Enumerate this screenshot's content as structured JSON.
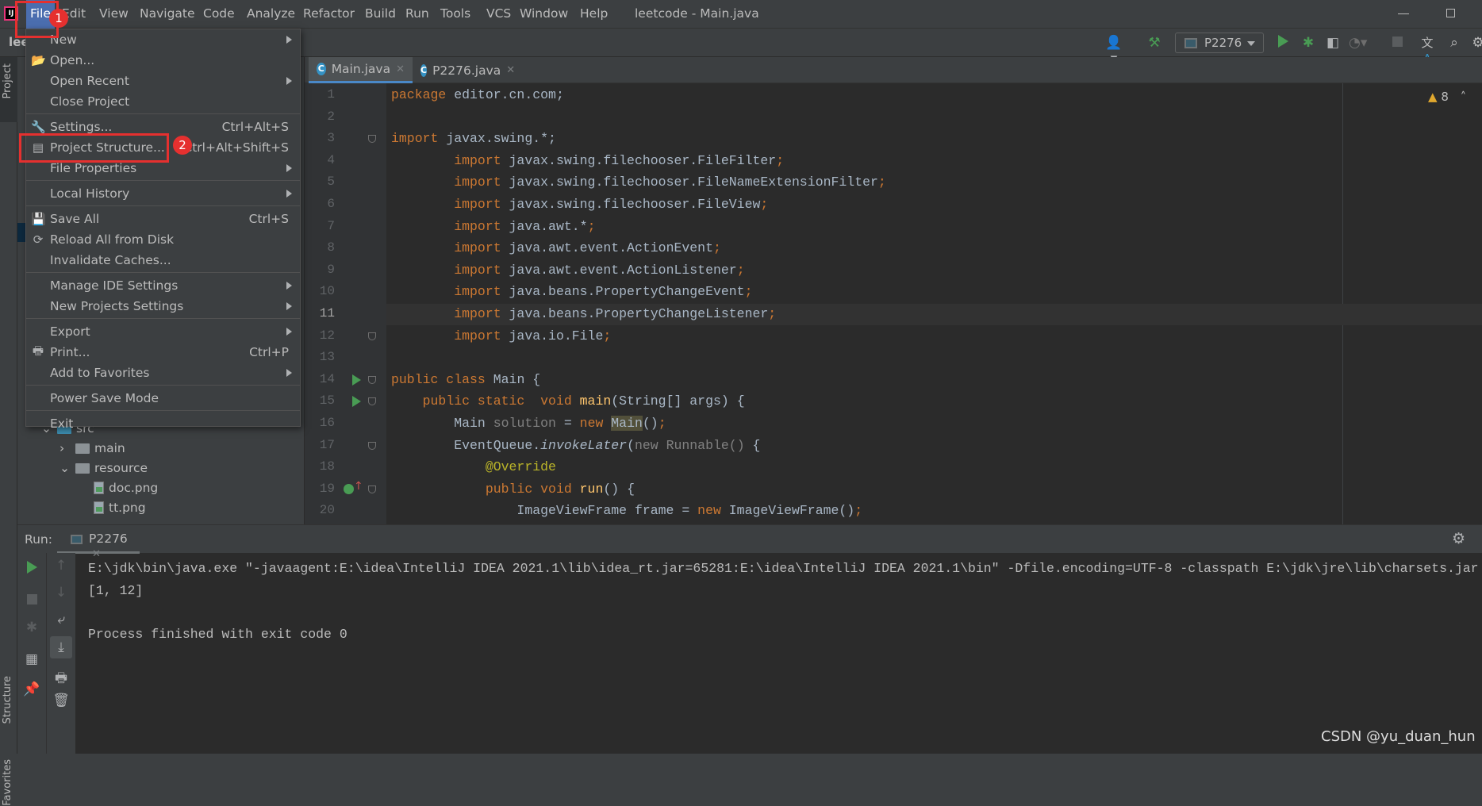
{
  "window": {
    "title": "leetcode - Main.java",
    "minimize_icon": "minimize-icon",
    "restore_icon": "restore-icon"
  },
  "menubar": [
    "File",
    "Edit",
    "View",
    "Navigate",
    "Code",
    "Analyze",
    "Refactor",
    "Build",
    "Run",
    "Tools",
    "VCS",
    "Window",
    "Help"
  ],
  "toolbar": {
    "project_name": "lee",
    "run_config": "P2276",
    "warnings": "8"
  },
  "sidebar_tabs": {
    "project": "Project",
    "structure": "Structure",
    "favorites": "Favorites"
  },
  "file_menu": [
    {
      "label": "New",
      "submenu": true
    },
    {
      "label": "Open...",
      "icon": "folder-open-icon"
    },
    {
      "label": "Open Recent",
      "submenu": true
    },
    {
      "label": "Close Project",
      "sep_after": true
    },
    {
      "label": "Settings...",
      "shortcut": "Ctrl+Alt+S",
      "icon": "wrench-icon"
    },
    {
      "label": "Project Structure...",
      "shortcut": "Ctrl+Alt+Shift+S",
      "icon": "project-structure-icon"
    },
    {
      "label": "File Properties",
      "submenu": true,
      "sep_after": true
    },
    {
      "label": "Local History",
      "submenu": true,
      "sep_after": true
    },
    {
      "label": "Save All",
      "shortcut": "Ctrl+S",
      "icon": "save-icon"
    },
    {
      "label": "Reload All from Disk",
      "icon": "reload-icon"
    },
    {
      "label": "Invalidate Caches...",
      "sep_after": true
    },
    {
      "label": "Manage IDE Settings",
      "submenu": true
    },
    {
      "label": "New Projects Settings",
      "submenu": true,
      "sep_after": true
    },
    {
      "label": "Export",
      "submenu": true
    },
    {
      "label": "Print...",
      "shortcut": "Ctrl+P",
      "icon": "print-icon"
    },
    {
      "label": "Add to Favorites",
      "submenu": true,
      "sep_after": true
    },
    {
      "label": "Power Save Mode",
      "sep_after": true
    },
    {
      "label": "Exit"
    }
  ],
  "annotations": {
    "step1": "1",
    "step2": "2"
  },
  "project_tree": [
    {
      "label": "src",
      "kind": "folder-src",
      "depth": 0,
      "expanded": true
    },
    {
      "label": "main",
      "kind": "folder",
      "depth": 1,
      "expanded": false
    },
    {
      "label": "resource",
      "kind": "folder",
      "depth": 1,
      "expanded": true
    },
    {
      "label": "doc.png",
      "kind": "image",
      "depth": 2
    },
    {
      "label": "tt.png",
      "kind": "image",
      "depth": 2
    }
  ],
  "tabs": [
    {
      "label": "Main.java",
      "active": true
    },
    {
      "label": "P2276.java",
      "active": false
    }
  ],
  "editor": {
    "current_line": 11,
    "lines": [
      [
        [
          "kw",
          "package "
        ],
        [
          "pl",
          "editor.cn.com;"
        ]
      ],
      [],
      [
        [
          "kw",
          "import "
        ],
        [
          "pl",
          "javax.swing.*;"
        ]
      ],
      [
        [
          "pl",
          "        "
        ],
        [
          "kw",
          "import "
        ],
        [
          "pl",
          "javax.swing.filechooser.FileFilter"
        ],
        [
          "kw",
          ";"
        ]
      ],
      [
        [
          "pl",
          "        "
        ],
        [
          "kw",
          "import "
        ],
        [
          "pl",
          "javax.swing.filechooser.FileNameExtensionFilter"
        ],
        [
          "kw",
          ";"
        ]
      ],
      [
        [
          "pl",
          "        "
        ],
        [
          "kw",
          "import "
        ],
        [
          "pl",
          "javax.swing.filechooser.FileView"
        ],
        [
          "kw",
          ";"
        ]
      ],
      [
        [
          "pl",
          "        "
        ],
        [
          "kw",
          "import "
        ],
        [
          "pl",
          "java.awt.*"
        ],
        [
          "kw",
          ";"
        ]
      ],
      [
        [
          "pl",
          "        "
        ],
        [
          "kw",
          "import "
        ],
        [
          "pl",
          "java.awt.event.ActionEvent"
        ],
        [
          "kw",
          ";"
        ]
      ],
      [
        [
          "pl",
          "        "
        ],
        [
          "kw",
          "import "
        ],
        [
          "pl",
          "java.awt.event.ActionListener"
        ],
        [
          "kw",
          ";"
        ]
      ],
      [
        [
          "pl",
          "        "
        ],
        [
          "kw",
          "import "
        ],
        [
          "pl",
          "java.beans.PropertyChangeEvent"
        ],
        [
          "kw",
          ";"
        ]
      ],
      [
        [
          "pl",
          "        "
        ],
        [
          "kw",
          "import "
        ],
        [
          "pl",
          "java.beans.PropertyChangeListener"
        ],
        [
          "kw",
          ";"
        ]
      ],
      [
        [
          "pl",
          "        "
        ],
        [
          "kw",
          "import "
        ],
        [
          "pl",
          "java.io.File"
        ],
        [
          "kw",
          ";"
        ]
      ],
      [],
      [
        [
          "kw",
          "public class "
        ],
        [
          "pl",
          "Main {"
        ]
      ],
      [
        [
          "pl",
          "    "
        ],
        [
          "kw",
          "public static  void "
        ],
        [
          "fn",
          "main"
        ],
        [
          "pl",
          "(String[] args) {"
        ]
      ],
      [
        [
          "pl",
          "        Main "
        ],
        [
          "gr",
          "solution"
        ],
        [
          "pl",
          " = "
        ],
        [
          "kw",
          "new "
        ],
        [
          "hl",
          "Main"
        ],
        [
          "pl",
          "()"
        ],
        [
          "kw",
          ";"
        ]
      ],
      [
        [
          "pl",
          "        EventQueue."
        ],
        [
          "it",
          "invokeLater"
        ],
        [
          "pl",
          "("
        ],
        [
          "gr",
          "new Runnable()"
        ],
        [
          "pl",
          " {"
        ]
      ],
      [
        [
          "pl",
          "            "
        ],
        [
          "an",
          "@Override"
        ]
      ],
      [
        [
          "pl",
          "            "
        ],
        [
          "kw",
          "public void "
        ],
        [
          "fn",
          "run"
        ],
        [
          "pl",
          "() {"
        ]
      ],
      [
        [
          "pl",
          "                ImageViewFrame frame = "
        ],
        [
          "kw",
          "new "
        ],
        [
          "pl",
          "ImageViewFrame()"
        ],
        [
          "kw",
          ";"
        ]
      ]
    ]
  },
  "run_panel": {
    "label": "Run:",
    "tab": "P2276",
    "output": [
      "E:\\jdk\\bin\\java.exe \"-javaagent:E:\\idea\\IntelliJ IDEA 2021.1\\lib\\idea_rt.jar=65281:E:\\idea\\IntelliJ IDEA 2021.1\\bin\" -Dfile.encoding=UTF-8 -classpath E:\\jdk\\jre\\lib\\charsets.jar",
      "[1, 12]",
      "",
      "Process finished with exit code 0"
    ]
  },
  "watermark": "CSDN @yu_duan_hun",
  "colors": {
    "accent": "#4B6EAF",
    "keyword": "#CC7832",
    "annotation": "#BBB529",
    "run_green": "#499C54",
    "highlight_red": "#E5302F"
  }
}
